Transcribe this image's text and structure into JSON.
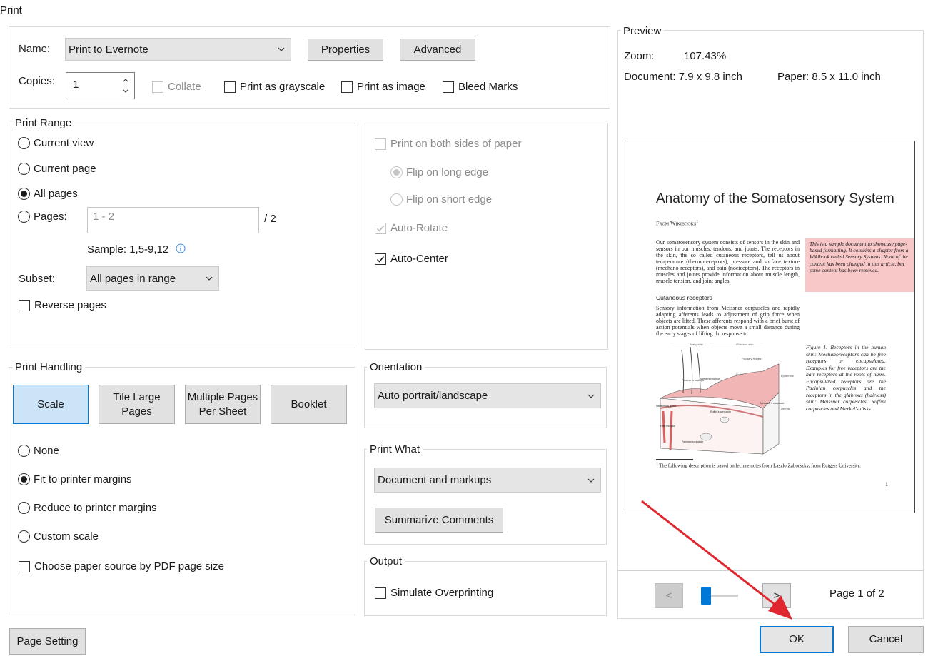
{
  "window": {
    "title": "Print"
  },
  "printer": {
    "name_label": "Name:",
    "name_value": "Print to Evernote",
    "properties_label": "Properties",
    "advanced_label": "Advanced",
    "copies_label": "Copies:",
    "copies_value": "1",
    "collate_label": "Collate",
    "grayscale_label": "Print as grayscale",
    "image_label": "Print as image",
    "bleed_label": "Bleed Marks"
  },
  "print_range": {
    "title": "Print Range",
    "current_view": "Current view",
    "current_page": "Current page",
    "all_pages": "All pages",
    "pages_label": "Pages:",
    "pages_placeholder": "1 - 2",
    "pages_total": "/ 2",
    "sample": "Sample: 1,5-9,12",
    "subset_label": "Subset:",
    "subset_value": "All pages in range",
    "reverse_label": "Reverse pages",
    "selected": "All pages"
  },
  "duplex": {
    "both_sides": "Print on both sides of paper",
    "flip_long": "Flip on long edge",
    "flip_short": "Flip on short edge",
    "auto_rotate": "Auto-Rotate",
    "auto_center": "Auto-Center"
  },
  "print_handling": {
    "title": "Print Handling",
    "tabs": [
      "Scale",
      "Tile Large Pages",
      "Multiple Pages Per Sheet",
      "Booklet"
    ],
    "active_tab": "Scale",
    "none": "None",
    "fit": "Fit to printer margins",
    "reduce": "Reduce to printer margins",
    "custom": "Custom scale",
    "paper_source": "Choose paper source by PDF page size",
    "selected": "Fit to printer margins"
  },
  "orientation": {
    "title": "Orientation",
    "value": "Auto portrait/landscape"
  },
  "print_what": {
    "title": "Print What",
    "value": "Document and markups",
    "summarize_label": "Summarize Comments"
  },
  "output": {
    "title": "Output",
    "simulate_label": "Simulate Overprinting"
  },
  "preview": {
    "title": "Preview",
    "zoom_label": "Zoom:",
    "zoom_value": "107.43%",
    "document_size": "Document: 7.9 x 9.8 inch",
    "paper_size": "Paper: 8.5 x 11.0 inch",
    "prev_label": "<",
    "next_label": ">",
    "page_indicator": "Page 1 of 2"
  },
  "document_preview": {
    "title": "Anatomy of the Somatosensory System",
    "byline": "From Wikibooks",
    "byline_footnote_mark": "1",
    "intro": "Our somatosensory system consists of sensors in the skin and sensors in our muscles, tendons, and joints. The receptors in the skin, the so called cutaneous receptors, tell us about temperature (thermoreceptors), pressure and surface texture (mechano receptors), and pain (nociceptors). The receptors in muscles and joints provide information about muscle length, muscle tension, and joint angles.",
    "sticky_note": "This is a sample document to showcase page-based formatting. It contains a chapter from a Wikibook called Sensory Systems. None of the content has been changed in this article, but some content has been removed.",
    "section": "Cutaneous receptors",
    "section_text": "Sensory information from Meissner corpuscles and rapidly adapting afferents leads to adjustment of grip force when objects are lifted. These afferents respond with a brief burst of action potentials when objects move a small distance during the early stages of lifting. In response to",
    "figure_caption": "Figure 1: Receptors in the human skin: Mechanoreceptors can be free receptors or encapsulated. Examples for free receptors are the hair receptors at the roots of hairs. Encapsulated receptors are the Pacinian corpuscles and the receptors in the glabrous (hairless) skin: Meissner corpuscles, Ruffini corpuscles and Merkel's disks.",
    "footnote": "The following description is based on lecture notes from Laszlo Zaborszky, from Rutgers University.",
    "footnote_mark": "1",
    "page_number": "1",
    "figure_labels": {
      "hairy_skin": "Hairy skin",
      "glabrous_skin": "Glabrous skin",
      "papillary_ridges": "Papillary Ridges",
      "septa": "Septa",
      "epidermis": "Epidermis",
      "dermis": "Dermis",
      "free_nerve": "Free nerve endings",
      "merkel": "Merkel's receptor",
      "sebaceous": "Sebaceous gland",
      "ruffini": "Ruffini's corpuscle",
      "meissner": "Meissner's corpuscle",
      "hair_receptor": "Hair receptor",
      "pacinian": "Pacinian corpuscle"
    }
  },
  "footer": {
    "page_setting_label": "Page Setting",
    "ok_label": "OK",
    "cancel_label": "Cancel"
  },
  "colors": {
    "accent": "#0078d7",
    "selected_tab": "#cce4f7",
    "note": "#f8c8c8",
    "arrow": "#e0262e"
  }
}
